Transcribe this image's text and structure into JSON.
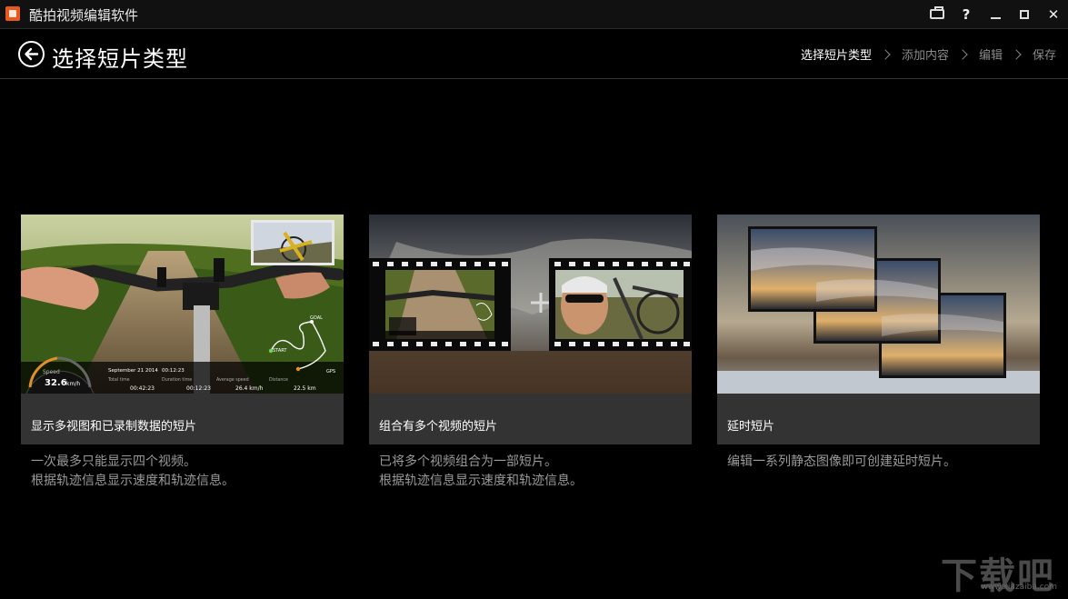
{
  "app": {
    "title": "酷拍视频编辑软件"
  },
  "window_buttons": {
    "help": "?",
    "close": "✕"
  },
  "header": {
    "title": "选择短片类型"
  },
  "steps": [
    {
      "label": "选择短片类型"
    },
    {
      "label": "添加内容"
    },
    {
      "label": "编辑"
    },
    {
      "label": "保存"
    }
  ],
  "cards": [
    {
      "label": "显示多视图和已录制数据的短片",
      "desc": [
        "一次最多只能显示四个视频。",
        "根据轨迹信息显示速度和轨迹信息。"
      ],
      "overlay": {
        "speed_label": "Speed",
        "speed_value": "32.6",
        "speed_unit": "km/h",
        "date": "September 21 2014",
        "clock": "00:12:23",
        "total_time_label": "Total time",
        "duration_label": "Duration time",
        "avg_speed_label": "Average speed",
        "distance_label": "Distance",
        "total_time": "00:42:23",
        "duration": "00:12:23",
        "avg_speed": "26.4 km/h",
        "distance": "22.5 km",
        "goal": "GOAL",
        "start": "START",
        "gps": "GPS"
      }
    },
    {
      "label": "组合有多个视频的短片",
      "desc": [
        "已将多个视频组合为一部短片。",
        "根据轨迹信息显示速度和轨迹信息。"
      ]
    },
    {
      "label": "延时短片",
      "desc": [
        "编辑一系列静态图像即可创建延时短片。"
      ]
    }
  ],
  "watermark": {
    "text": "下载吧",
    "url": "www.xiazaiba.com"
  }
}
